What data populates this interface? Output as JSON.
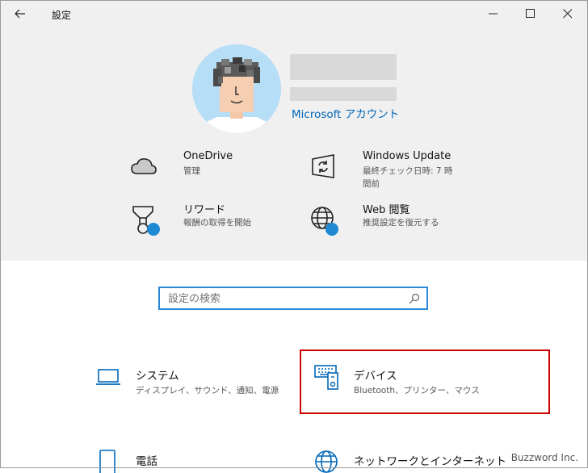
{
  "window": {
    "title": "設定",
    "buttons": [
      "back",
      "minimize",
      "maximize",
      "close"
    ]
  },
  "profile": {
    "account_link": "Microsoft アカウント"
  },
  "quick_items": [
    {
      "title": "OneDrive",
      "subtitle": "管理",
      "icon": "cloud-icon"
    },
    {
      "title": "Windows Update",
      "subtitle": "最終チェック日時: 7 時間前",
      "icon": "update-icon"
    },
    {
      "title": "リワード",
      "subtitle": "報酬の取得を開始",
      "icon": "reward-icon"
    },
    {
      "title": "Web 閲覧",
      "subtitle": "推奨設定を復元する",
      "icon": "globe-icon"
    }
  ],
  "search": {
    "placeholder": "設定の検索"
  },
  "categories": [
    {
      "title": "システム",
      "subtitle": "ディスプレイ、サウンド、通知、電源",
      "icon": "laptop-icon"
    },
    {
      "title": "デバイス",
      "subtitle": "Bluetooth、プリンター、マウス",
      "icon": "devices-icon"
    },
    {
      "title": "電話",
      "subtitle": "",
      "icon": "phone-icon"
    },
    {
      "title": "ネットワークとインターネット",
      "subtitle": "",
      "icon": "network-icon"
    }
  ],
  "watermark": "Buzzword Inc.",
  "colors": {
    "accent": "#0067b8",
    "search_border": "#2b88d8",
    "highlight": "#cc0000",
    "header_bg": "#f0f0f0",
    "badge": "#1e88d2"
  }
}
